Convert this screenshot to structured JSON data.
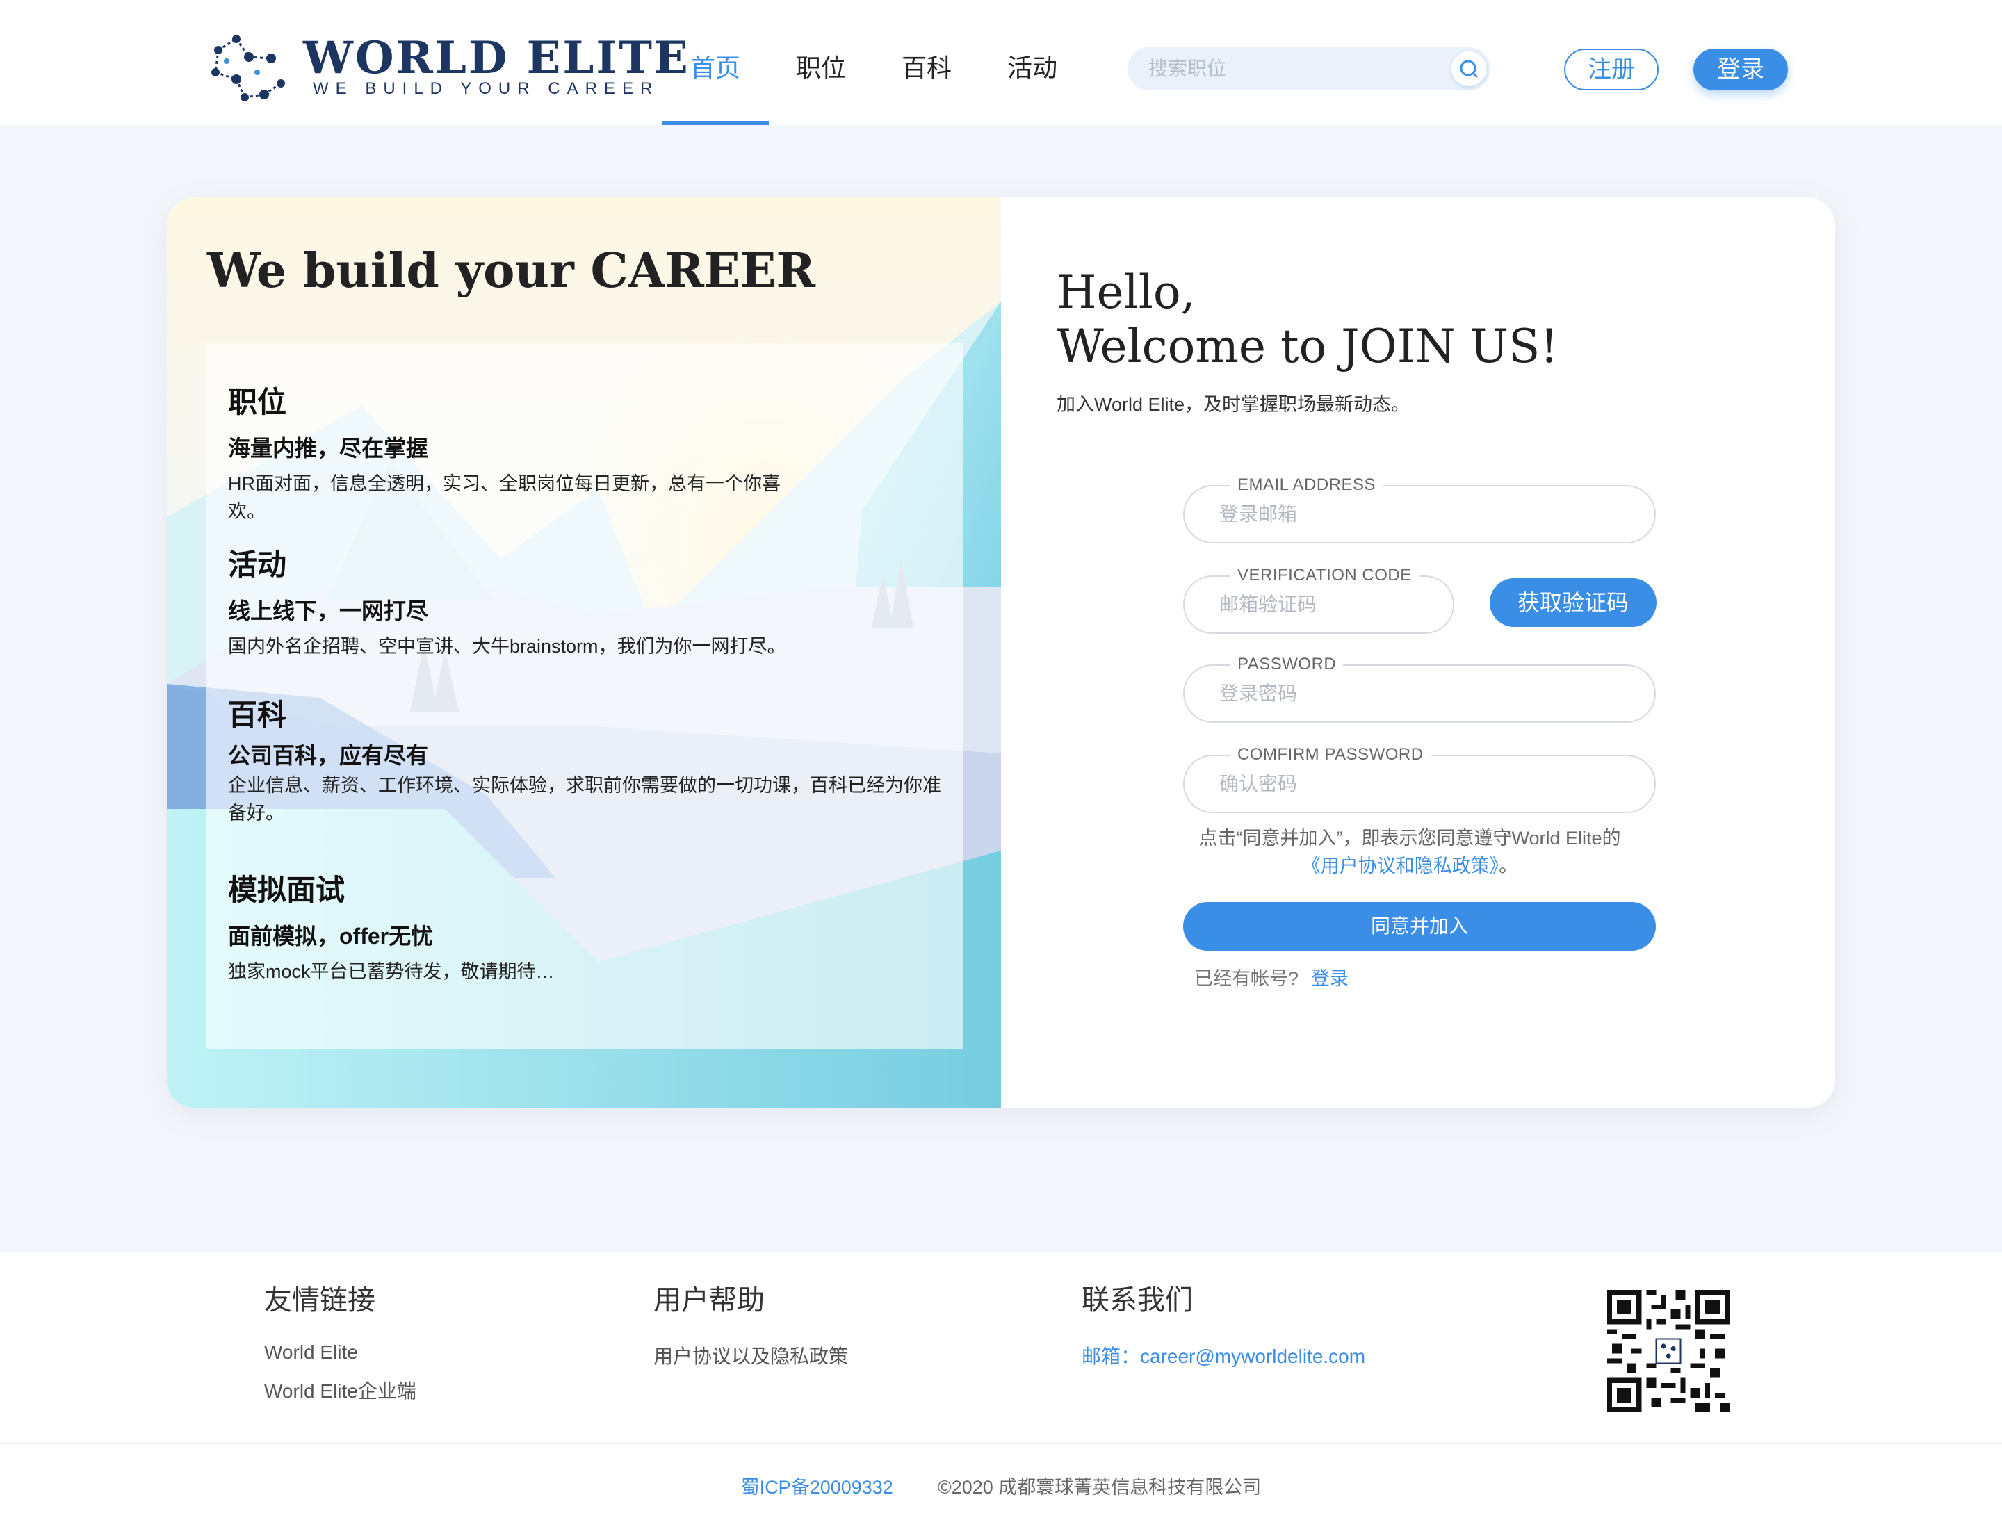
{
  "header": {
    "logo_title": "WORLD ELITE",
    "logo_subtitle": "WE BUILD YOUR CAREER",
    "nav": [
      {
        "label": "首页",
        "active": true
      },
      {
        "label": "职位",
        "active": false
      },
      {
        "label": "百科",
        "active": false
      },
      {
        "label": "活动",
        "active": false
      }
    ],
    "search_placeholder": "搜索职位",
    "register_label": "注册",
    "login_label": "登录"
  },
  "left": {
    "title": "We build your CAREER",
    "features": [
      {
        "head": "职位",
        "sub": "海量内推，尽在掌握",
        "desc": "HR面对面，信息全透明，实习、全职岗位每日更新，总有一个你喜欢。"
      },
      {
        "head": "活动",
        "sub": "线上线下，一网打尽",
        "desc": "国内外名企招聘、空中宣讲、大牛brainstorm，我们为你一网打尽。"
      },
      {
        "head": "百科",
        "sub": "公司百科，应有尽有",
        "desc": "企业信息、薪资、工作环境、实际体验，求职前你需要做的一切功课，百科已经为你准备好。"
      },
      {
        "head": "模拟面试",
        "sub": "面前模拟，offer无忧",
        "desc": "独家mock平台已蓄势待发，敬请期待…"
      }
    ]
  },
  "form": {
    "hello_line1": "Hello,",
    "hello_line2": "Welcome to JOIN US!",
    "subtitle": "加入World Elite，及时掌握职场最新动态。",
    "email_label": "EMAIL ADDRESS",
    "email_placeholder": "登录邮箱",
    "code_label": "VERIFICATION CODE",
    "code_placeholder": "邮箱验证码",
    "get_code": "获取验证码",
    "password_label": "PASSWORD",
    "password_placeholder": "登录密码",
    "confirm_label": "COMFIRM PASSWORD",
    "confirm_placeholder": "确认密码",
    "agree_prefix": "点击“同意并加入”，即表示您同意遵守World Elite的",
    "agree_link": "《用户协议和隐私政策》",
    "agree_suffix": "。",
    "join_button": "同意并加入",
    "have_account": "已经有帐号?",
    "login_link": "登录"
  },
  "footer": {
    "links_title": "友情链接",
    "links": [
      "World Elite",
      "World Elite企业端"
    ],
    "help_title": "用户帮助",
    "help_items": [
      "用户协议以及隐私政策"
    ],
    "contact_title": "联系我们",
    "contact_email": "邮箱：career@myworldelite.com",
    "icp": "蜀ICP备20009332",
    "copyright": "©2020 成都寰球菁英信息科技有限公司"
  },
  "colors": {
    "accent": "#3a8ee6",
    "logo_navy": "#1d3661",
    "highlight": "#f7c948",
    "page_bg": "#f3f6fa"
  },
  "icons": [
    "logo-network-icon",
    "search-icon",
    "qr-code-icon"
  ]
}
